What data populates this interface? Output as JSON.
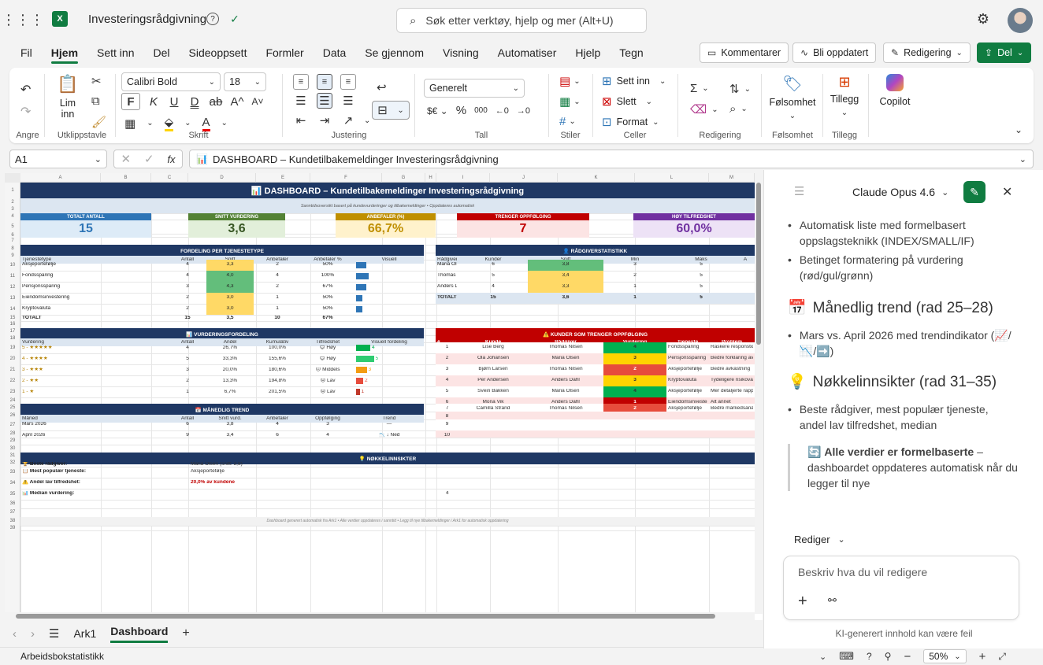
{
  "app": {
    "title": "Investeringsrådgivning",
    "search_placeholder": "Søk etter verktøy, hjelp og mer (Alt+U)"
  },
  "menu": {
    "tabs": [
      "Fil",
      "Hjem",
      "Sett inn",
      "Del",
      "Sideoppsett",
      "Formler",
      "Data",
      "Se gjennom",
      "Visning",
      "Automatiser",
      "Hjelp",
      "Tegn"
    ],
    "active": "Hjem"
  },
  "header_buttons": {
    "comments": "Kommentarer",
    "updates": "Bli oppdatert",
    "editing": "Redigering",
    "share": "Del"
  },
  "ribbon": {
    "undo_label": "Angre",
    "paste_label": "Lim",
    "paste_label2": "inn",
    "clipboard_label": "Utklippstavle",
    "font_name": "Calibri Bold",
    "font_size": "18",
    "font_label": "Skrift",
    "align_label": "Justering",
    "number_format": "Generelt",
    "number_label": "Tall",
    "styles_label": "Stiler",
    "insert_label": "Sett inn",
    "delete_label": "Slett",
    "format_label": "Format",
    "cells_label": "Celler",
    "editing_label": "Redigering",
    "sensitivity_label": "Følsomhet",
    "sensitivity_btn": "Følsomhet",
    "addins_label": "Tillegg",
    "addins_btn": "Tillegg",
    "copilot_label": "Copilot",
    "bold_glyph": "F",
    "italic_glyph": "K",
    "underline_glyph": "U",
    "double_underline_glyph": "D",
    "strike_glyph": "ab",
    "font_grow_glyph": "A^",
    "font_shrink_glyph": "A˅",
    "percent_glyph": "%",
    "thousands_glyph": "000"
  },
  "formula_bar": {
    "cell_ref": "A1",
    "content": "DASHBOARD – Kundetilbakemeldinger Investeringsrådgivning"
  },
  "sheet": {
    "columns": [
      "A",
      "B",
      "C",
      "D",
      "E",
      "F",
      "G",
      "H",
      "I",
      "J",
      "K",
      "L",
      "M"
    ],
    "rows": [
      "1",
      "2",
      "3",
      "4",
      "5",
      "6",
      "7",
      "8",
      "9",
      "10",
      "11",
      "12",
      "13",
      "14",
      "15",
      "16",
      "17",
      "18",
      "19",
      "20",
      "21",
      "22",
      "23",
      "24",
      "25",
      "26",
      "27",
      "28",
      "29",
      "30",
      "31",
      "32",
      "33",
      "34",
      "35",
      "36",
      "37",
      "38",
      "39"
    ],
    "title": "DASHBOARD – Kundetilbakemeldinger Investeringsrådgivning",
    "subtitle": "Sanntidsoversikt basert på kundevurderinger og tilbakemeldinger  •  Oppdateres automatisk",
    "kpis": [
      {
        "label": "TOTALT ANTALL",
        "value": "15",
        "color": "#2e75b6",
        "bg": "#ddebf7",
        "fg": "#2e75b6"
      },
      {
        "label": "SNITT VURDERING",
        "value": "3,6",
        "color": "#548235",
        "bg": "#e2efda",
        "fg": "#375623"
      },
      {
        "label": "ANBEFALER (%)",
        "value": "66,7%",
        "color": "#bf8f00",
        "bg": "#fff2cc",
        "fg": "#bf8f00"
      },
      {
        "label": "TRENGER OPPFØLGING",
        "value": "7",
        "color": "#c00000",
        "bg": "#fce4e4",
        "fg": "#c00000"
      },
      {
        "label": "HØY TILFREDSHET",
        "value": "60,0%",
        "color": "#7030a0",
        "bg": "#ede2f6",
        "fg": "#7030a0"
      }
    ],
    "service": {
      "title": "FORDELING PER TJENESTETYPE",
      "headers": [
        "Tjenestetype",
        "Antall",
        "Snitt",
        "Anbefaler",
        "Anbefaler %",
        "Visuell"
      ],
      "rows": [
        [
          "Aksjeportefølje",
          "4",
          "3,3",
          "2",
          "50%"
        ],
        [
          "Fondssparing",
          "4",
          "4,0",
          "4",
          "100%"
        ],
        [
          "Pensjonssparing",
          "3",
          "4,3",
          "2",
          "67%"
        ],
        [
          "Eiendomsinvestering",
          "2",
          "3,0",
          "1",
          "50%"
        ],
        [
          "Kryptovaluta",
          "2",
          "3,0",
          "1",
          "50%"
        ]
      ],
      "total": [
        "TOTALT",
        "15",
        "3,5",
        "10",
        "67%"
      ],
      "bars": [
        0.5,
        0.6,
        0.5,
        0.3,
        0.3
      ]
    },
    "advisor": {
      "title": "RÅDGIVERSTATISTIKK",
      "headers": [
        "Rådgiver",
        "Kunder",
        "Snitt",
        "Min",
        "Maks"
      ],
      "rows": [
        [
          "Maria Ol",
          "6",
          "3,8",
          "3",
          "5"
        ],
        [
          "Thomas N",
          "5",
          "3,4",
          "2",
          "5"
        ],
        [
          "Anders D",
          "4",
          "3,3",
          "1",
          "5"
        ]
      ],
      "total": [
        "TOTALT /",
        "15",
        "3,6",
        "1",
        "5"
      ]
    },
    "rating": {
      "title": "VURDERINGSFORDELING",
      "headers": [
        "Vurdering",
        "Antall",
        "Andel",
        "Kumulativ",
        "Tilfredshet",
        "Visuell fordeling"
      ],
      "rows": [
        [
          "5 - ★★★★★",
          "4",
          "26,7%",
          "100,0%",
          "😊 Høy",
          "4"
        ],
        [
          "4 - ★★★★",
          "5",
          "33,3%",
          "155,6%",
          "😊 Høy",
          "5"
        ],
        [
          "3 - ★★★",
          "3",
          "20,0%",
          "180,6%",
          "😐 Middels",
          "3"
        ],
        [
          "2 - ★★",
          "2",
          "13,3%",
          "194,8%",
          "😞 Lav",
          "2"
        ],
        [
          "1 - ★",
          "1",
          "6,7%",
          "201,5%",
          "😞 Lav",
          "1"
        ]
      ],
      "bar_colors": [
        "#00b050",
        "#2ecc71",
        "#f39c12",
        "#e74c3c",
        "#c0392b"
      ]
    },
    "trend": {
      "title": "MÅNEDLIG TREND",
      "headers": [
        "Måned",
        "Antall",
        "Snitt vurd.",
        "Anbefaler",
        "Oppfølging",
        "Trend"
      ],
      "rows": [
        [
          "Mars 2026",
          "6",
          "3,8",
          "4",
          "3",
          "—"
        ],
        [
          "April 2026",
          "9",
          "3,4",
          "6",
          "4",
          "📉 ↓ Ned"
        ]
      ]
    },
    "followup": {
      "title": "KUNDER SOM TRENGER OPPFØLGING",
      "headers": [
        "#",
        "Kunde",
        "Rådgiver",
        "Vurdering",
        "Tjeneste",
        "Problem"
      ],
      "rows": [
        [
          "1",
          "Lise Berg",
          "Thomas Nilsen",
          "4",
          "Fondssparing",
          "Raskere responstid"
        ],
        [
          "2",
          "Ola Johansen",
          "Maria Olsen",
          "3",
          "Pensjonssparing",
          "Bedre forklaring av"
        ],
        [
          "3",
          "Bjørn Larsen",
          "Thomas Nilsen",
          "2",
          "Aksjeportefølje",
          "Bedre avkastning"
        ],
        [
          "4",
          "Per Andersen",
          "Anders Dahl",
          "3",
          "Kryptovaluta",
          "Tydeligere risikoval"
        ],
        [
          "5",
          "Svein Bakken",
          "Maria Olsen",
          "4",
          "Aksjeportefølje",
          "Mer detaljerte rapp"
        ],
        [
          "6",
          "Mona Vik",
          "Anders Dahl",
          "1",
          "Eiendomsinvestering",
          "Alt annet"
        ],
        [
          "7",
          "Camilla Strand",
          "Thomas Nilsen",
          "2",
          "Aksjeportefølje",
          "Bedre markedsana"
        ]
      ],
      "empty": [
        "8",
        "9",
        "10"
      ]
    },
    "insights": {
      "title": "NØKKELINNSIKTER",
      "rows": [
        [
          "🏆 Beste rådgiver:",
          "Maria Olsen (snitt: 3,8)"
        ],
        [
          "📋 Mest populær tjeneste:",
          "Aksjeportefølje"
        ],
        [
          "⚠️ Andel lav tilfredshet:",
          "20,0% av kundene"
        ],
        [
          "📊 Median vurdering:",
          "4"
        ]
      ]
    },
    "footer": "Dashboard generert automatisk fra Ark1  •  Alle verdier oppdateres i sanntid  •  Legg til nye tilbakemeldinger i Ark1 for automatisk oppdatering"
  },
  "sheet_tabs": [
    "Ark1",
    "Dashboard"
  ],
  "active_sheet": "Dashboard",
  "status": {
    "left": "Arbeidsbokstatistikk",
    "zoom": "50%"
  },
  "pane": {
    "model": "Claude Opus 4.6",
    "bullets1": [
      "Automatisk liste med formelbasert oppslagsteknikk (INDEX/SMALL/IF)",
      "Betinget formatering på vurdering (rød/gul/grønn)"
    ],
    "h_trend": "Månedlig trend (rad 25–28)",
    "bullets2": [
      "Mars vs. April 2026 med trendindikator (📈/📉/➡️)"
    ],
    "h_insights": "Nøkkelinnsikter (rad 31–35)",
    "bullets3": [
      "Beste rådgiver, mest populær tjeneste, andel lav tilfredshet, median"
    ],
    "note_bold": "Alle verdier er formelbaserte",
    "note_rest": " – dashboardet oppdateres automatisk når du legger til nye",
    "mode": "Rediger",
    "input_placeholder": "Beskriv hva du vil redigere",
    "disclaimer": "KI-generert innhold kan være feil"
  }
}
